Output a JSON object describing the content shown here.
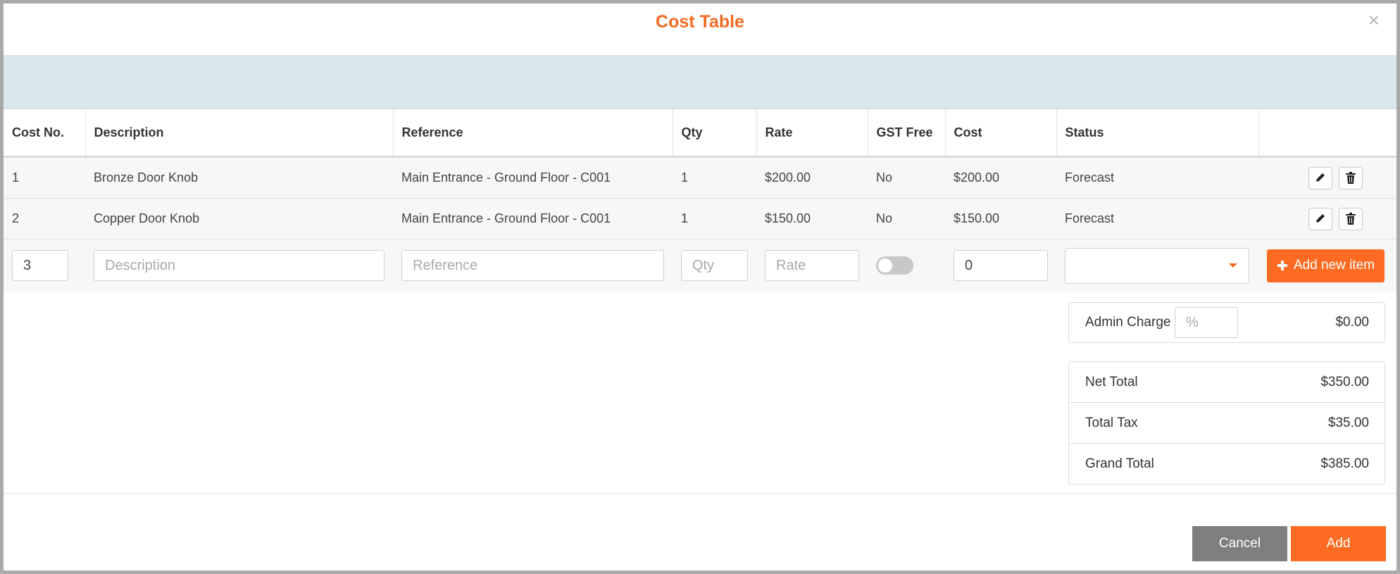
{
  "modal": {
    "title": "Cost Table",
    "close_label": "×"
  },
  "table": {
    "headers": [
      "Cost No.",
      "Description",
      "Reference",
      "Qty",
      "Rate",
      "GST Free",
      "Cost",
      "Status",
      ""
    ],
    "rows": [
      {
        "no": "1",
        "description": "Bronze Door Knob",
        "reference": "Main Entrance - Ground Floor - C001",
        "qty": "1",
        "rate": "$200.00",
        "gst_free": "No",
        "cost": "$200.00",
        "status": "Forecast"
      },
      {
        "no": "2",
        "description": "Copper Door Knob",
        "reference": "Main Entrance - Ground Floor - C001",
        "qty": "1",
        "rate": "$150.00",
        "gst_free": "No",
        "cost": "$150.00",
        "status": "Forecast"
      }
    ]
  },
  "entry": {
    "cost_no_value": "3",
    "description_placeholder": "Description",
    "reference_placeholder": "Reference",
    "qty_placeholder": "Qty",
    "rate_placeholder": "Rate",
    "gst_free_on": false,
    "cost_value": "0",
    "status_value": "",
    "add_item_label": "Add new item"
  },
  "admin": {
    "label": "Admin Charge",
    "placeholder": "%",
    "value": "$0.00"
  },
  "totals": [
    {
      "label": "Net Total",
      "value": "$350.00"
    },
    {
      "label": "Total Tax",
      "value": "$35.00"
    },
    {
      "label": "Grand Total",
      "value": "$385.00"
    }
  ],
  "footer": {
    "cancel_label": "Cancel",
    "add_label": "Add"
  },
  "colors": {
    "accent": "#fd6b22",
    "title": "#f46a21",
    "band": "#dae8ee",
    "cancel": "#7f7f7f"
  },
  "icons": {
    "edit": "pencil-icon",
    "delete": "trash-icon",
    "add": "plus-icon",
    "dropdown": "caret-down-icon",
    "close": "close-icon"
  }
}
